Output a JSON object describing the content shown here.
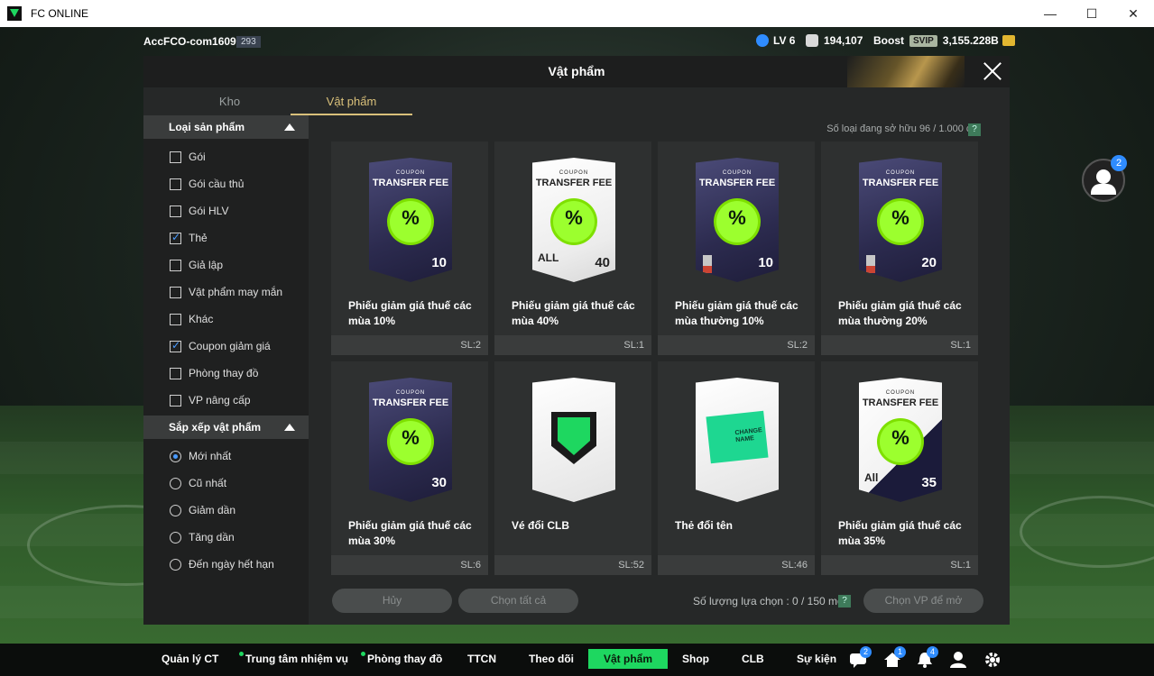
{
  "window": {
    "title": "FC ONLINE",
    "minimize": "—",
    "maximize": "☐",
    "close": "✕"
  },
  "topbar": {
    "account": "AccFCO-com1609g",
    "account_badge": "293",
    "level": "LV 6",
    "points": "194,107",
    "boost_label": "Boost",
    "svip_label": "SVIP",
    "currency": "3,155.228B"
  },
  "modal": {
    "title": "Vật phẩm",
    "tabs": [
      {
        "label": "Kho"
      },
      {
        "label": "Vật phẩm"
      }
    ],
    "owned_label": "Số loại đang sở hữu",
    "owned_value": "96 / 1.000 cái",
    "help": "?"
  },
  "filters": {
    "product_type": {
      "title": "Loại sản phẩm",
      "options": [
        {
          "label": "Gói",
          "checked": false
        },
        {
          "label": "Gói cầu thủ",
          "checked": false
        },
        {
          "label": "Gói HLV",
          "checked": false
        },
        {
          "label": "Thẻ",
          "checked": true
        },
        {
          "label": "Giả lập",
          "checked": false
        },
        {
          "label": "Vật phẩm may mắn",
          "checked": false
        },
        {
          "label": "Khác",
          "checked": false
        },
        {
          "label": "Coupon giảm giá",
          "checked": true
        },
        {
          "label": "Phòng thay đồ",
          "checked": false
        },
        {
          "label": "VP nâng cấp",
          "checked": false
        }
      ]
    },
    "sort": {
      "title": "Sắp xếp vật phẩm",
      "options": [
        {
          "label": "Mới nhất",
          "selected": true
        },
        {
          "label": "Cũ nhất",
          "selected": false
        },
        {
          "label": "Giảm dần",
          "selected": false
        },
        {
          "label": "Tăng dần",
          "selected": false
        },
        {
          "label": "Đến ngày hết hạn",
          "selected": false
        }
      ]
    }
  },
  "items": [
    {
      "name": "Phiếu giảm giá thuế các mùa 10%",
      "qty": "SL:2",
      "card": {
        "style": "dark",
        "top": "COUPON",
        "title": "TRANSFER FEE",
        "percent": "10",
        "badge": "%"
      }
    },
    {
      "name": "Phiếu giảm giá thuế các mùa 40%",
      "qty": "SL:1",
      "card": {
        "style": "light",
        "top": "COUPON",
        "title": "TRANSFER FEE",
        "percent": "40",
        "badge": "%",
        "class": "ALL"
      }
    },
    {
      "name": "Phiếu giảm giá thuế các mùa thường 10%",
      "qty": "SL:2",
      "card": {
        "style": "dark",
        "top": "COUPON",
        "title": "TRANSFER FEE",
        "percent": "10",
        "badge": "%"
      }
    },
    {
      "name": "Phiếu giảm giá thuế các mùa thường 20%",
      "qty": "SL:1",
      "card": {
        "style": "dark",
        "top": "COUPON",
        "title": "TRANSFER FEE",
        "percent": "20",
        "badge": "%"
      }
    },
    {
      "name": "Phiếu giảm giá thuế các mùa 30%",
      "qty": "SL:6",
      "card": {
        "style": "dark",
        "top": "COUPON",
        "title": "TRANSFER FEE",
        "percent": "30",
        "badge": "%"
      }
    },
    {
      "name": "Vé đổi CLB",
      "qty": "SL:52",
      "card": {
        "style": "club"
      }
    },
    {
      "name": "Thẻ đổi tên",
      "qty": "SL:46",
      "card": {
        "style": "rename",
        "text": "CHANGE NAME"
      }
    },
    {
      "name": "Phiếu giảm giá thuế các mùa 35%",
      "qty": "SL:1",
      "card": {
        "style": "lightdiag",
        "top": "COUPON",
        "title": "TRANSFER FEE",
        "percent": "35",
        "badge": "%",
        "class": "All"
      }
    }
  ],
  "footer": {
    "cancel_label": "Hủy",
    "select_all_label": "Chọn tất cả",
    "selection_label": "Số lượng lựa chọn : 0 / 150 món",
    "help": "?",
    "select_item_label": "Chọn VP để mở"
  },
  "chat": {
    "count": "2"
  },
  "nav": {
    "items": [
      {
        "label": "Quản lý CT"
      },
      {
        "label": "Trung tâm nhiệm vụ"
      },
      {
        "label": "Phòng thay đồ"
      },
      {
        "label": "TTCN"
      },
      {
        "label": "Theo dõi"
      },
      {
        "label": "Vật phẩm"
      },
      {
        "label": "Shop"
      },
      {
        "label": "CLB"
      },
      {
        "label": "Sự kiện"
      }
    ],
    "badges": {
      "chat": "2",
      "home": "1",
      "bell": "4"
    }
  },
  "colors": {
    "accent": "#1ed760",
    "gold": "#d9c07a",
    "badge_blue": "#2f8cff"
  }
}
